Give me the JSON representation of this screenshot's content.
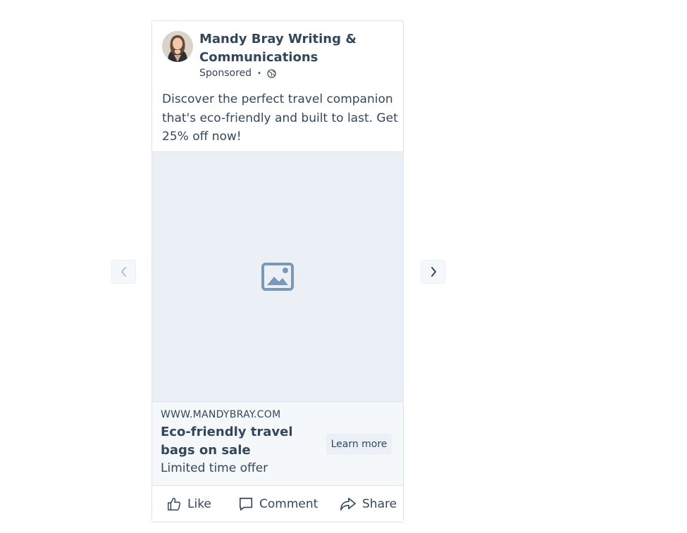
{
  "post": {
    "author": "Mandy Bray Writing & Communications",
    "sponsored_label": "Sponsored",
    "separator": "•",
    "body": "Discover the perfect travel companion that's eco-friendly and built to last. Get 25% off now!",
    "media_icon": "image-placeholder-icon"
  },
  "link_preview": {
    "url": "WWW.MANDYBRAY.COM",
    "headline": "Eco-friendly travel bags on sale",
    "description": "Limited time offer",
    "cta_label": "Learn more"
  },
  "actions": {
    "like_label": "Like",
    "comment_label": "Comment",
    "share_label": "Share"
  },
  "carousel": {
    "prev_icon": "chevron-left-icon",
    "next_icon": "chevron-right-icon"
  },
  "colors": {
    "text": "#33475b",
    "media_bg": "#eaf0f6",
    "placeholder_icon": "#7c98b6",
    "border": "#dfe3eb"
  }
}
